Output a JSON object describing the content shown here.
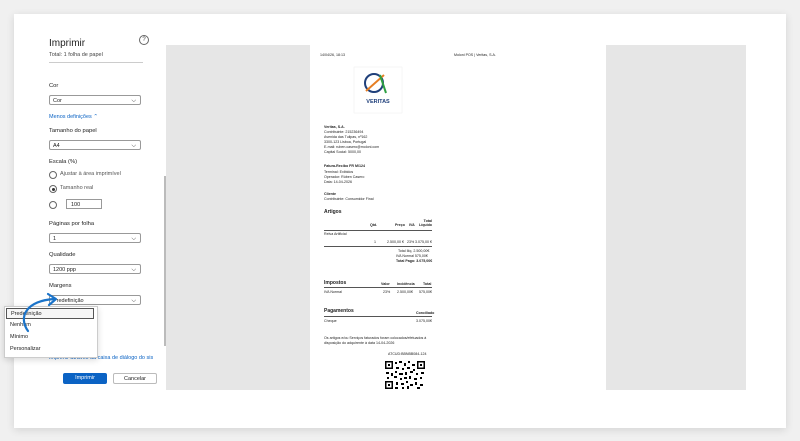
{
  "print_panel": {
    "title": "Imprimir",
    "subtitle": "Total: 1 folha de papel",
    "help_symbol": "?",
    "color": {
      "label": "Cor",
      "value": "Cor"
    },
    "less_settings_link": "Menos definições ⌃",
    "paper_size": {
      "label": "Tamanho do papel",
      "value": "A4"
    },
    "scale": {
      "label": "Escala (%)",
      "option_fit": "Ajustar à área imprimível",
      "option_actual": "Tamanho real",
      "custom_value": "100"
    },
    "pages_per_sheet": {
      "label": "Páginas por folha",
      "value": "1"
    },
    "quality": {
      "label": "Qualidade",
      "value": "1200 ppp"
    },
    "margins": {
      "label": "Margens",
      "value": "Predefinição",
      "options": [
        "Predefinição",
        "Nenhum",
        "Mínimo",
        "Personalizar"
      ]
    },
    "system_dialog_link": "Imprimir através da caixa de diálogo do sistema...",
    "print_button": "Imprimir",
    "cancel_button": "Cancelar"
  },
  "document": {
    "header_left": "14/04/26, 18:13",
    "header_right": "Moloni POS | Veritas, S.A.",
    "logo_text": "VERITAS",
    "company": {
      "name": "Veritas, S.A.",
      "nif": "Contribuinte: 215236494",
      "address1": "Avenida das Tulipas, nº162",
      "address2": "3300-123 Lisboa, Portugal",
      "email": "E-mail: ruben.casero@moloni.com",
      "capital": "Capital Social: 5000,00"
    },
    "invoice": {
      "title": "Fatura-Recibo FR M/124",
      "terminal": "Terminal: Exibidos",
      "operator": "Operador: Rúben Casero",
      "date": "Data: 14-04-2026"
    },
    "client": {
      "title": "Cliente",
      "value": "Contribuinte: Consumidor Final"
    },
    "articles": {
      "title": "Artigos",
      "headers": [
        "Qtd.",
        "Preço",
        "IVA",
        "Total Líquido"
      ],
      "item_name": "Relva Artificial",
      "item_row": [
        "1",
        "2.500,00 €",
        "23%",
        "3.075,00 €"
      ],
      "totals": [
        "Total Ilíq.  2.500,00€",
        "IVA Normal  575,00€",
        "Total Pago: 3.075,00€"
      ]
    },
    "taxes": {
      "title": "Impostos",
      "headers": [
        "Valor",
        "Incidência",
        "Total"
      ],
      "row": [
        "IVA Normal",
        "23%",
        "2.500,00€",
        "575,00€"
      ]
    },
    "payments": {
      "title": "Pagamentos",
      "header": "Conciliado",
      "row": [
        "Cheque",
        "3.075,00€"
      ]
    },
    "footer_line1": "Os artigos e/ou Serviços faturados foram colocados/efetuados à",
    "footer_line2": "disposição do adquirente à data 14-04-2026",
    "atcud": "ATCUD:BBNBB084-124"
  },
  "colors": {
    "accent": "#0b63c4",
    "arrow": "#1a73c9"
  }
}
